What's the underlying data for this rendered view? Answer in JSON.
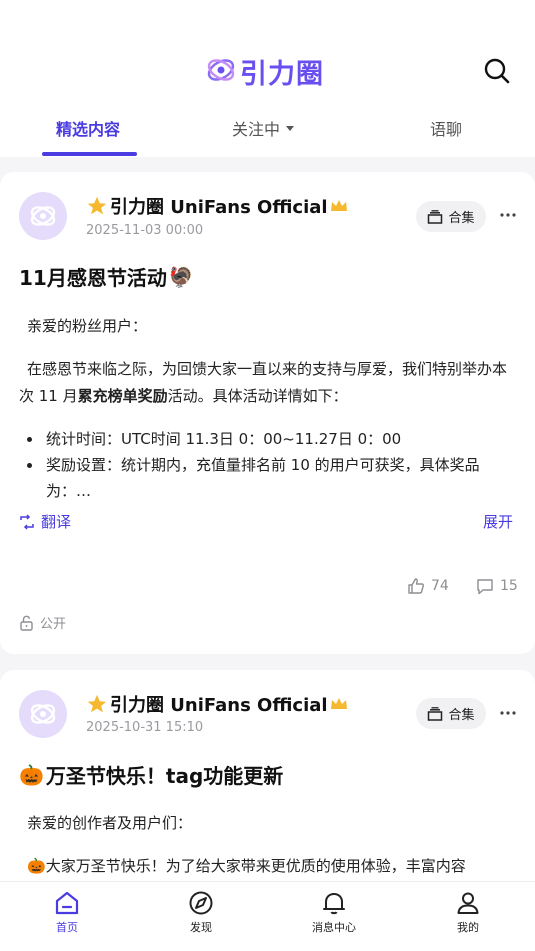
{
  "app": {
    "logo_text": "引力圈"
  },
  "header": {
    "tabs": [
      {
        "label": "精选内容",
        "active": true
      },
      {
        "label": "关注中",
        "has_dropdown": true
      },
      {
        "label": "语聊"
      }
    ]
  },
  "posts": [
    {
      "author": "引力圈 UniFans Official",
      "date": "2025-11-03 00:00",
      "collection_label": "合集",
      "title": "11月感恩节活动",
      "title_emoji": "🦃",
      "greeting": "亲爱的粉丝用户：",
      "body_part1": "在感恩节来临之际，为回馈大家一直以来的支持与厚爱，我们特别举办本次 11 月",
      "body_bold": "累充榜单奖励",
      "body_part2": "活动。具体活动详情如下：",
      "bullets": [
        "统计时间：UTC时间 11.3日 0：00~11.27日 0：00",
        "奖励设置：统计期内，充值量排名前 10 的用户可获奖，具体奖品为：…"
      ],
      "translate_label": "翻译",
      "expand_label": "展开",
      "likes": "74",
      "comments": "15",
      "visibility": "公开"
    },
    {
      "author": "引力圈 UniFans Official",
      "date": "2025-10-31 15:10",
      "collection_label": "合集",
      "title_emoji": "🎃",
      "title": "万圣节快乐！tag功能更新",
      "greeting": "亲爱的创作者及用户们：",
      "body_emoji": "🎃",
      "body": "大家万圣节快乐！为了给大家带来更优质的使用体验，丰富内容"
    }
  ],
  "tabbar": [
    {
      "label": "首页",
      "icon": "home-icon",
      "active": true
    },
    {
      "label": "发现",
      "icon": "compass-icon"
    },
    {
      "label": "消息中心",
      "icon": "bell-icon"
    },
    {
      "label": "我的",
      "icon": "user-icon"
    }
  ],
  "colors": {
    "accent": "#4a3ce0",
    "logo": "#6a4ff0",
    "badge_gold": "#f5b82e"
  }
}
